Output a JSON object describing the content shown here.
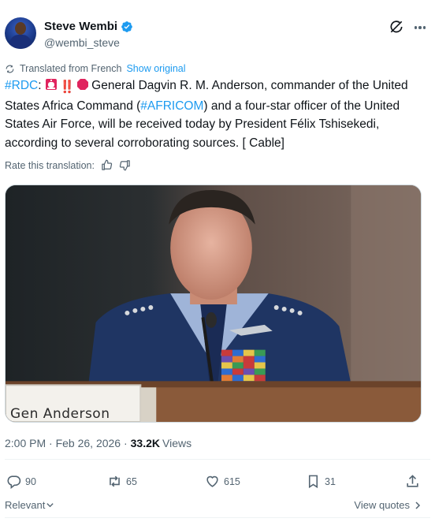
{
  "author": {
    "display_name": "Steve Wembi",
    "handle": "@wembi_steve",
    "verified": true,
    "avatar_icon": "avatar-photo"
  },
  "translation": {
    "note": "Translated from French",
    "show_original": "Show original"
  },
  "tweet": {
    "hashtag_rdc": "#RDC",
    "after_rdc": ":",
    "emoji_bang": "‼️",
    "text_part1": "General Dagvin R. M. Anderson, commander of the United States Africa Command (",
    "hashtag_africom": "#AFRICOM",
    "text_part2": ") and a four-star officer of the United States Air Force, will be received today by President Félix Tshisekedi, according to several corroborating sources. [ Cable]"
  },
  "rate": {
    "label": "Rate this translation:"
  },
  "media": {
    "nameplate": "Gen Anderson"
  },
  "meta": {
    "time_date": "2:00 PM · Feb 26, 2026 ·",
    "views_count": "33.2K",
    "views_label": "Views"
  },
  "actions": {
    "replies": "90",
    "reposts": "65",
    "likes": "615",
    "bookmarks": "31"
  },
  "bottom": {
    "sort_label": "Relevant",
    "view_quotes": "View quotes"
  },
  "colors": {
    "accent": "#1d9bf0",
    "muted": "#536471",
    "text": "#0f1419"
  }
}
